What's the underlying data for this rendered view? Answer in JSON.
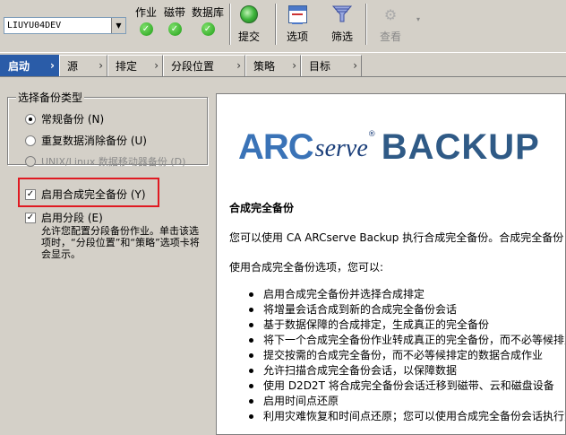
{
  "toolbar": {
    "server": "LIUYU04DEV",
    "status": [
      {
        "label": "作业"
      },
      {
        "label": "磁带"
      },
      {
        "label": "数据库"
      }
    ],
    "submit_label": "提交",
    "options_label": "选项",
    "filter_label": "筛选",
    "view_label": "查看"
  },
  "tabs": [
    {
      "label": "启动"
    },
    {
      "label": "源"
    },
    {
      "label": "排定"
    },
    {
      "label": "分段位置"
    },
    {
      "label": "策略"
    },
    {
      "label": "目标"
    }
  ],
  "backup_type": {
    "group_title": "选择备份类型",
    "options": [
      {
        "label": "常规备份 (N)",
        "selected": true
      },
      {
        "label": "重复数据消除备份 (U)",
        "selected": false
      },
      {
        "label": "UNIX/Linux 数据移动器备份 (D)",
        "selected": false,
        "disabled": true
      }
    ]
  },
  "checkboxes": {
    "synthetic_label": "启用合成完全备份 (Y)",
    "synthetic_checked": true,
    "staging_label": "启用分段 (E)",
    "staging_checked": true,
    "staging_help": "允许您配置分段备份作业。单击该选项时，“分段位置”和“策略”选项卡将会显示。"
  },
  "info_panel": {
    "logo_arc": "ARC",
    "logo_serve": "serve",
    "logo_reg": "®",
    "logo_backup": "BACKUP",
    "heading": "合成完全备份",
    "intro": "您可以使用  CA ARCserve Backup 执行合成完全备份。合成完全备份",
    "lead": "使用合成完全备份选项，您可以:",
    "bullets": [
      "启用合成完全备份并选择合成排定",
      "将增量会话合成到新的合成完全备份会话",
      "基于数据保障的合成排定，生成真正的完全备份",
      "将下一个合成完全备份作业转成真正的完全备份，而不必等候排定",
      "提交按需的合成完全备份，而不必等候排定的数据合成作业",
      "允许扫描合成完全备份会话，以保障数据",
      "使用  D2D2T 将合成完全备份会话迁移到磁带、云和磁盘设备",
      "启用时间点还原",
      "利用灾难恢复和时间点还原；您可以使用合成完全备份会话执行灾难恢复"
    ]
  },
  "colors": {
    "active_tab": "#2a5ca8",
    "highlight_box": "#e01a22",
    "logo_blue": "#3a73b7"
  }
}
